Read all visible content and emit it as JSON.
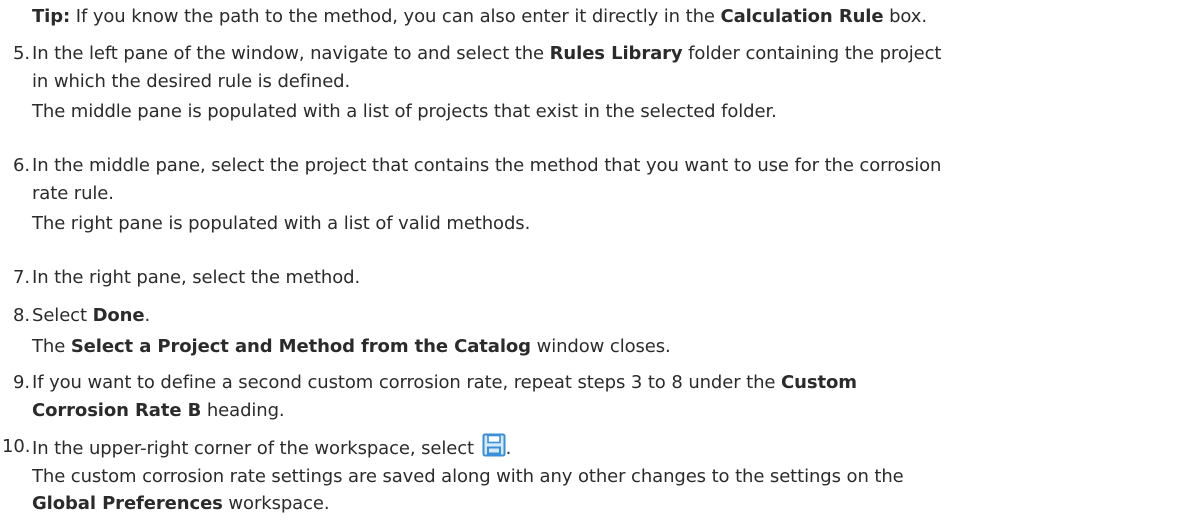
{
  "tip": {
    "label": "Tip:",
    "text1": " If you know the path to the method, you can also enter it directly in the ",
    "bold1": "Calculation Rule",
    "text2": " box."
  },
  "steps": [
    {
      "num": "5.",
      "l1a": "In the left pane of the window, navigate to and select the ",
      "l1b": "Rules Library",
      "l1c": " folder containing the project",
      "l2": "in which the desired rule is defined.",
      "l3": "The middle pane is populated with a list of projects that exist in the selected folder."
    },
    {
      "num": "6.",
      "l1": "In the middle pane, select the project that contains the method that you want to use for the corrosion",
      "l2": "rate rule.",
      "l3": "The right pane is populated with a list of valid methods."
    },
    {
      "num": "7.",
      "l1": "In the right pane, select the method."
    },
    {
      "num": "8.",
      "l1a": "Select ",
      "l1b": "Done",
      "l1c": ".",
      "l2a": "The ",
      "l2b": "Select a Project and Method from the Catalog",
      "l2c": " window closes."
    },
    {
      "num": "9.",
      "l1a": "If you want to define a second custom corrosion rate, repeat steps 3 to 8 under the ",
      "l1b": "Custom",
      "l2a": "Corrosion Rate B",
      "l2b": " heading."
    },
    {
      "num": "10.",
      "l1a": "In the upper-right corner of the workspace, select ",
      "l1b": ".",
      "l2": "The custom corrosion rate settings are saved along with any other changes to the settings on the",
      "l3a": "Global Preferences",
      "l3b": " workspace."
    }
  ],
  "icons": {
    "save": "save-icon"
  },
  "colors": {
    "text": "#2b2b2b",
    "save_icon": "#3a8fd9"
  }
}
